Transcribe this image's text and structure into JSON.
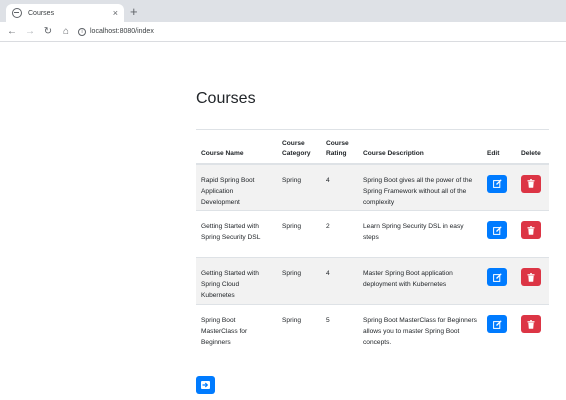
{
  "browser": {
    "tab_title": "Courses",
    "tab_close": "×",
    "new_tab": "+",
    "url": "localhost:8080/index"
  },
  "page": {
    "title": "Courses"
  },
  "table": {
    "headers": {
      "name": "Course Name",
      "category": "Course Category",
      "rating": "Course Rating",
      "description": "Course Description",
      "edit": "Edit",
      "delete": "Delete"
    },
    "rows": [
      {
        "name": "Rapid Spring Boot Application Development",
        "category": "Spring",
        "rating": "4",
        "description": "Spring Boot gives all the power of the Spring Framework without all of the complexity"
      },
      {
        "name": "Getting Started with Spring Security DSL",
        "category": "Spring",
        "rating": "2",
        "description": "Learn Spring Security DSL in easy steps"
      },
      {
        "name": "Getting Started with Spring Cloud Kubernetes",
        "category": "Spring",
        "rating": "4",
        "description": "Master Spring Boot application deployment with Kubernetes"
      },
      {
        "name": "Spring Boot MasterClass for Beginners",
        "category": "Spring",
        "rating": "5",
        "description": "Spring Boot MasterClass for Beginners allows you to master Spring Boot concepts."
      }
    ]
  },
  "icons": {
    "edit": "edit-icon",
    "delete": "trash-icon",
    "add": "arrow-right-icon"
  },
  "colors": {
    "primary": "#007bff",
    "danger": "#dc3545",
    "stripe": "#f2f2f2"
  }
}
